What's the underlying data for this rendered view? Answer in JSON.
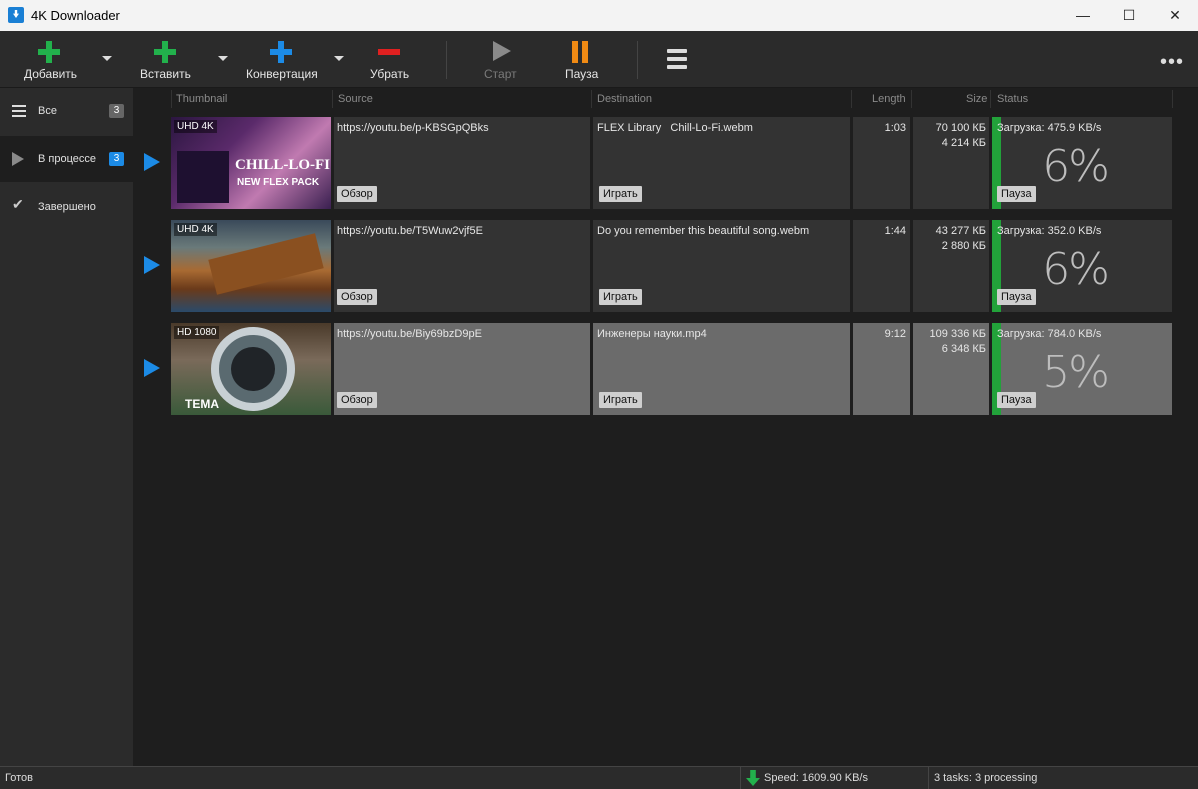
{
  "window": {
    "title": "4K Downloader"
  },
  "toolbar": {
    "add_label": "Добавить",
    "paste_label": "Вставить",
    "convert_label": "Конвертация",
    "remove_label": "Убрать",
    "start_label": "Старт",
    "pause_label": "Пауза"
  },
  "sidebar": {
    "items": [
      {
        "label": "Все",
        "count": "3"
      },
      {
        "label": "В процессе",
        "count": "3"
      },
      {
        "label": "Завершено",
        "count": ""
      }
    ]
  },
  "columns": {
    "thumbnail": "Thumbnail",
    "source": "Source",
    "destination": "Destination",
    "length": "Length",
    "size": "Size",
    "status": "Status"
  },
  "rows": [
    {
      "quality": "UHD 4K",
      "thumb_text": "CHILL-LO-FI NEW FLEX PACK",
      "source": "https://youtu.be/p-KBSGpQBks",
      "destination_prefix": "FLEX Library",
      "destination": "Chill-Lo-Fi.webm",
      "length": "1:03",
      "size_total": "70 100 КБ",
      "size_done": "4 214 КБ",
      "status": "Загрузка: 475.9 KB/s",
      "percent": "6%",
      "progress": 0.06,
      "browse_label": "Обзор",
      "play_label": "Играть",
      "pause_label": "Пауза"
    },
    {
      "quality": "UHD 4K",
      "thumb_text": "",
      "source": "https://youtu.be/T5Wuw2vjf5E",
      "destination_prefix": "",
      "destination": "Do you remember this beautiful song.webm",
      "length": "1:44",
      "size_total": "43 277 КБ",
      "size_done": "2 880 КБ",
      "status": "Загрузка: 352.0 KB/s",
      "percent": "6%",
      "progress": 0.06,
      "browse_label": "Обзор",
      "play_label": "Играть",
      "pause_label": "Пауза"
    },
    {
      "quality": "HD 1080",
      "thumb_text": "ТЕМА",
      "source": "https://youtu.be/Biy69bzD9pE",
      "destination_prefix": "",
      "destination": "Инженеры науки.mp4",
      "length": "9:12",
      "size_total": "109 336 КБ",
      "size_done": "6 348 КБ",
      "status": "Загрузка: 784.0 KB/s",
      "percent": "5%",
      "progress": 0.05,
      "browse_label": "Обзор",
      "play_label": "Играть",
      "pause_label": "Пауза"
    }
  ],
  "statusbar": {
    "ready": "Готов",
    "speed": "Speed: 1609.90 KB/s",
    "tasks": "3 tasks: 3 processing"
  },
  "colors": {
    "accent_blue": "#1c8be6",
    "add_green": "#22b14c",
    "remove_red": "#e02020",
    "pause_orange": "#f08a14",
    "progress_green": "#22a23a"
  }
}
